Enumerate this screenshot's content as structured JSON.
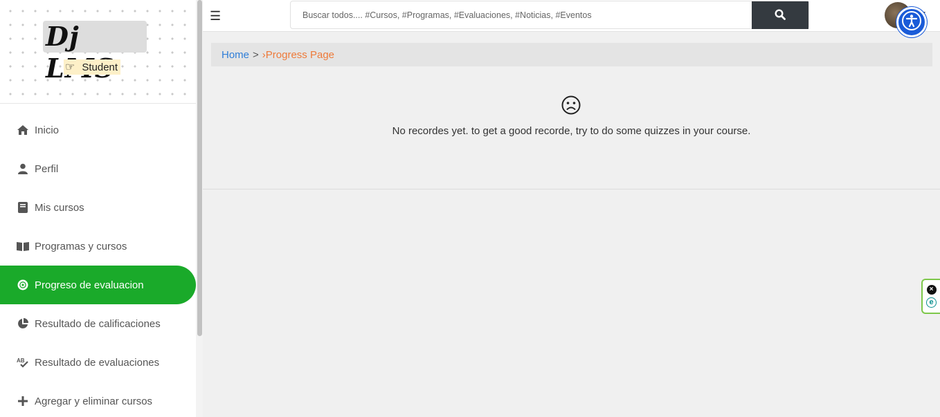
{
  "brand": {
    "logo_text": "Dj LMS",
    "role_label": "Student",
    "role_icon": "pointing-hand-icon"
  },
  "sidebar": {
    "items": [
      {
        "label": "Inicio",
        "icon": "home-icon"
      },
      {
        "label": "Perfil",
        "icon": "user-icon"
      },
      {
        "label": "Mis cursos",
        "icon": "book-icon"
      },
      {
        "label": "Programas y cursos",
        "icon": "open-book-icon"
      },
      {
        "label": "Progreso de evaluacion",
        "icon": "target-icon",
        "active": true
      },
      {
        "label": "Resultado de calificaciones",
        "icon": "pie-chart-icon"
      },
      {
        "label": "Resultado de evaluaciones",
        "icon": "spellcheck-icon"
      },
      {
        "label": "Agregar y eliminar cursos",
        "icon": "plus-icon"
      }
    ],
    "active_color": "#1aaa2a"
  },
  "topbar": {
    "menu_icon": "hamburger-icon",
    "search_placeholder": "Buscar todos.... #Cursos, #Programas, #Evaluaciones, #Noticias, #Eventos",
    "search_button_icon": "search-icon"
  },
  "breadcrumb": {
    "home": "Home",
    "separator": ">",
    "current": "›Progress Page"
  },
  "empty_state": {
    "icon": "sad-face-icon",
    "message": "No recordes yet. to get a good recorde, try to do some quizzes in your course."
  },
  "widgets": {
    "accessibility_icon": "accessibility-icon",
    "close_icon": "close-icon",
    "e_icon": "e-icon"
  }
}
